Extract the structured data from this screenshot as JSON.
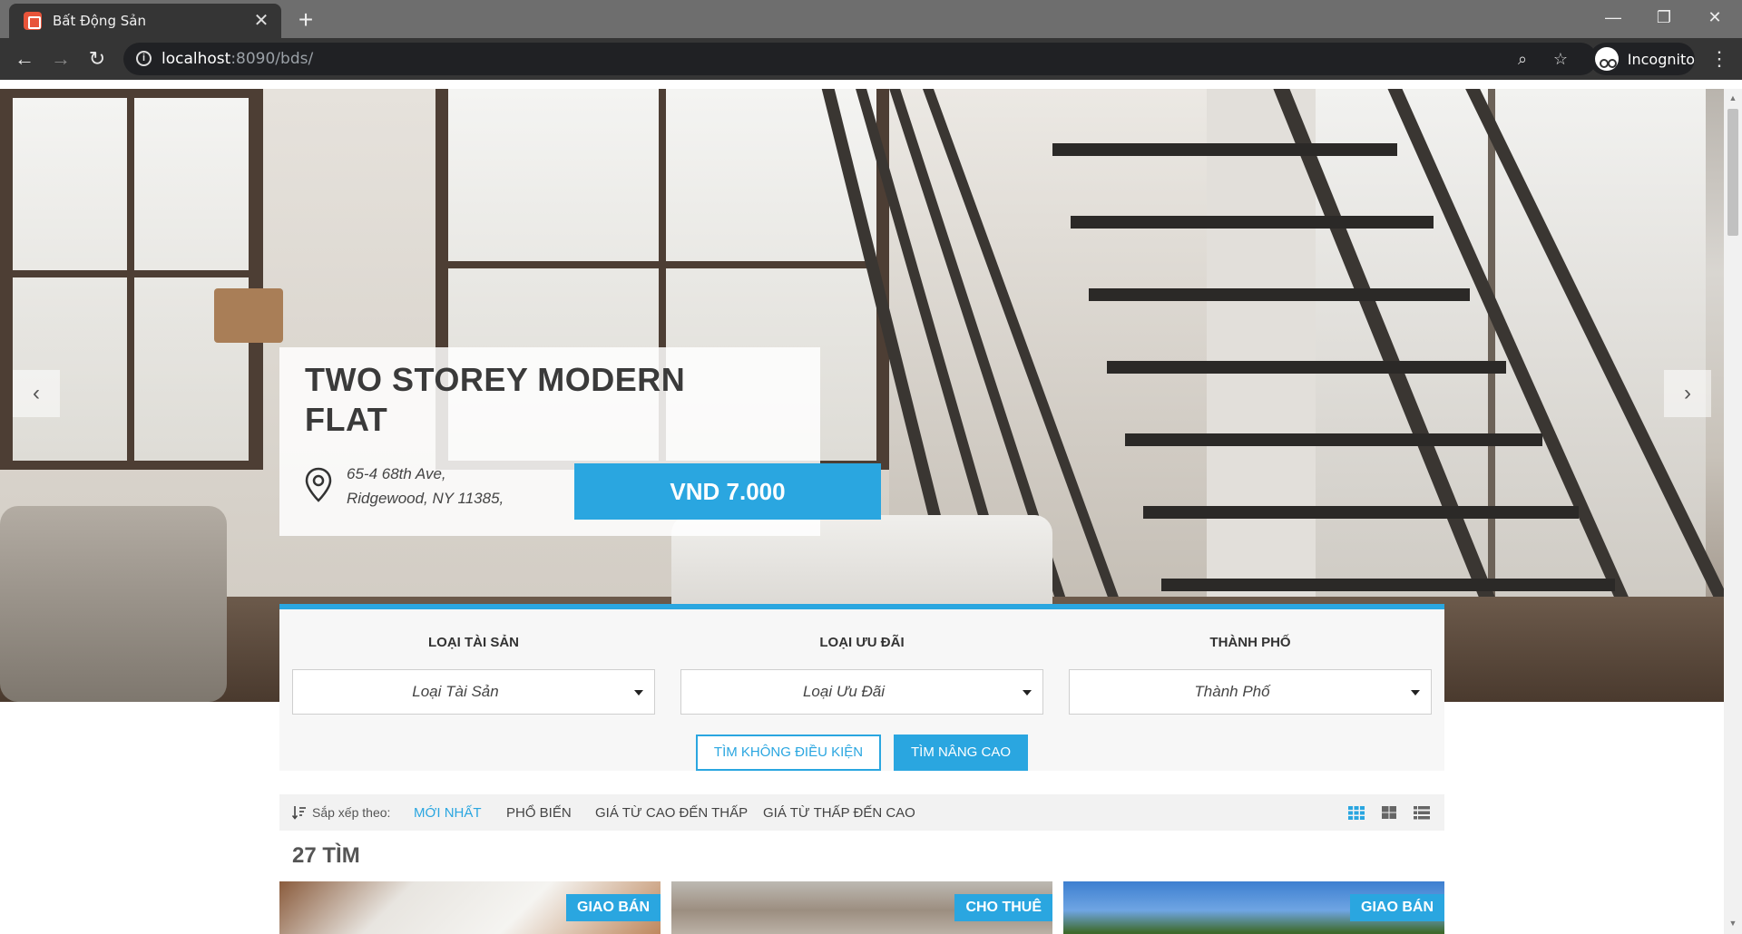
{
  "browser": {
    "tab_title": "Bất Động Sản",
    "url_host": "localhost",
    "url_path": ":8090/bds/",
    "profile_label": "Incognito"
  },
  "hero": {
    "title": "TWO STOREY MODERN FLAT",
    "address_line1": "65-4 68th Ave,",
    "address_line2": "Ridgewood, NY 11385,",
    "price": "VND 7.000"
  },
  "search": {
    "fields": [
      {
        "label": "LOẠI TÀI SẢN",
        "value": "Loại Tài Sản"
      },
      {
        "label": "LOẠI ƯU ĐÃI",
        "value": "Loại Ưu Đãi"
      },
      {
        "label": "THÀNH PHỐ",
        "value": "Thành Phố"
      }
    ],
    "basic_button": "TÌM KHÔNG ĐIỀU KIỆN",
    "advanced_button": "TÌM NÂNG CAO"
  },
  "sort": {
    "label": "Sắp xếp theo:",
    "options": [
      "MỚI NHẤT",
      "PHỔ BIẾN",
      "GIÁ TỪ CAO ĐẾN THẤP",
      "GIÁ TỪ THẤP ĐẾN CAO"
    ],
    "active_index": 0
  },
  "results": {
    "count_label": "27 TÌM",
    "cards": [
      {
        "badge": "GIAO BÁN"
      },
      {
        "badge": "CHO THUÊ"
      },
      {
        "badge": "GIAO BÁN"
      }
    ]
  },
  "colors": {
    "accent": "#2aa6e0"
  }
}
